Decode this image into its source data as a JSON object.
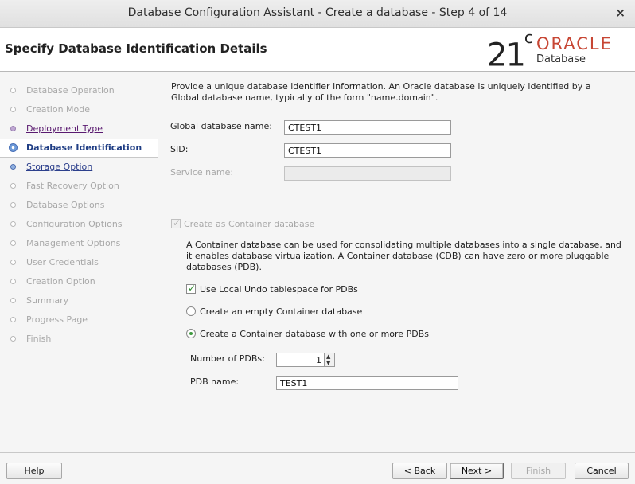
{
  "window": {
    "title": "Database Configuration Assistant - Create a database - Step 4 of 14",
    "close_glyph": "×"
  },
  "header": {
    "page_title": "Specify Database Identification Details",
    "logo": {
      "version": "21",
      "version_sup": "c",
      "brand": "ORACLE",
      "product": "Database"
    }
  },
  "sidebar": {
    "steps": [
      {
        "label": "Database Operation",
        "state": "done"
      },
      {
        "label": "Creation Mode",
        "state": "done"
      },
      {
        "label": "Deployment Type",
        "state": "visited"
      },
      {
        "label": "Database Identification",
        "state": "current"
      },
      {
        "label": "Storage Option",
        "state": "next"
      },
      {
        "label": "Fast Recovery Option",
        "state": "disabled"
      },
      {
        "label": "Database Options",
        "state": "disabled"
      },
      {
        "label": "Configuration Options",
        "state": "disabled"
      },
      {
        "label": "Management Options",
        "state": "disabled"
      },
      {
        "label": "User Credentials",
        "state": "disabled"
      },
      {
        "label": "Creation Option",
        "state": "disabled"
      },
      {
        "label": "Summary",
        "state": "disabled"
      },
      {
        "label": "Progress Page",
        "state": "disabled"
      },
      {
        "label": "Finish",
        "state": "disabled"
      }
    ]
  },
  "content": {
    "intro": "Provide a unique database identifier information. An Oracle database is uniquely identified by a Global database name, typically of the form \"name.domain\".",
    "global_db_name": {
      "label": "Global database name:",
      "value": "CTEST1"
    },
    "sid": {
      "label": "SID:",
      "value": "CTEST1"
    },
    "service_name": {
      "label": "Service name:",
      "value": ""
    },
    "container_checkbox": {
      "label": "Create as Container database",
      "checked": true,
      "enabled": false
    },
    "container_desc": "A Container database can be used for consolidating multiple databases into a single database, and it enables database virtualization. A Container database (CDB) can have zero or more pluggable databases (PDB).",
    "local_undo": {
      "label": "Use Local Undo tablespace for PDBs",
      "checked": true
    },
    "radio_empty": {
      "label": "Create an empty Container database",
      "selected": false
    },
    "radio_with_pdbs": {
      "label": "Create a Container database with one or more PDBs",
      "selected": true
    },
    "num_pdbs": {
      "label": "Number of PDBs:",
      "value": "1"
    },
    "pdb_name": {
      "label": "PDB name:",
      "value": "TEST1"
    }
  },
  "footer": {
    "help": "Help",
    "back": "< Back",
    "next": "Next >",
    "finish": "Finish",
    "cancel": "Cancel"
  },
  "colors": {
    "brand_red": "#c74634",
    "current_step": "#1f3d84",
    "visited_link": "#5a1a70",
    "next_link": "#2c3f8c",
    "check_green": "#2f8a2f"
  }
}
